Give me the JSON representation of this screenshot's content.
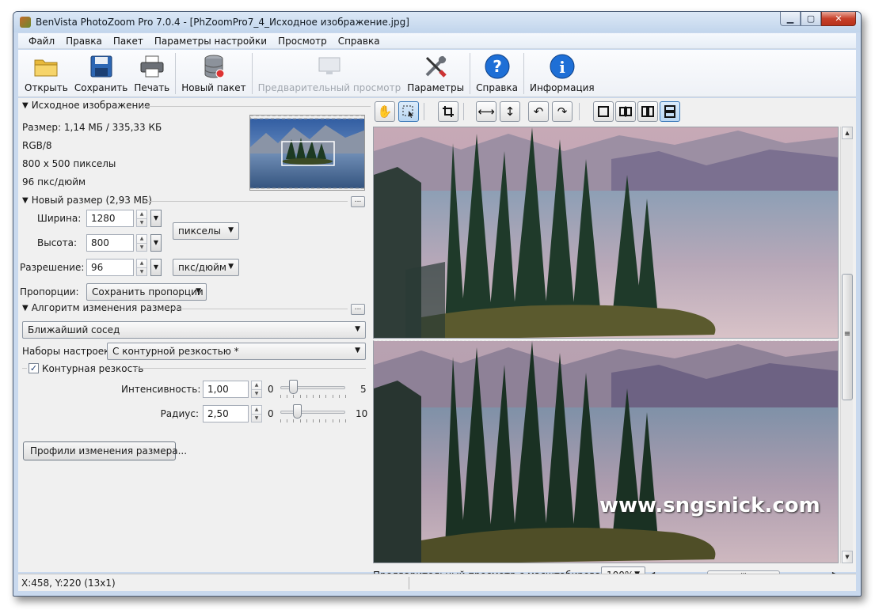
{
  "window": {
    "title": "BenVista PhotoZoom Pro 7.0.4 - [PhZoomPro7_4_Исходное изображение.jpg]"
  },
  "menu": [
    "Файл",
    "Правка",
    "Пакет",
    "Параметры настройки",
    "Просмотр",
    "Справка"
  ],
  "toolbar": {
    "open": "Открыть",
    "save": "Сохранить",
    "print": "Печать",
    "new_batch": "Новый пакет",
    "preview": "Предварительный просмотр",
    "settings": "Параметры",
    "help": "Справка",
    "info": "Информация"
  },
  "source": {
    "header": "Исходное изображение",
    "size": "Размер: 1,14 МБ / 335,33 КБ",
    "mode": "RGB/8",
    "dimensions": "800 x 500 пикселы",
    "dpi": "96 пкс/дюйм"
  },
  "new_size": {
    "header": "Новый размер (2,93 МБ)",
    "width_label": "Ширина:",
    "width_value": "1280",
    "height_label": "Высота:",
    "height_value": "800",
    "units": "пикселы",
    "resolution_label": "Разрешение:",
    "resolution_value": "96",
    "resolution_units": "пкс/дюйм",
    "proportions_label": "Пропорции:",
    "proportions_value": "Сохранить пропорции",
    "more_button": "..."
  },
  "algorithm": {
    "header": "Алгоритм изменения размера",
    "method": "Ближайший сосед",
    "presets_label": "Наборы настроек:",
    "presets_value": "С контурной резкостью *",
    "more_button": "..."
  },
  "sharpen": {
    "checkbox_label": "Контурная резкость",
    "checked": true,
    "intensity_label": "Интенсивность:",
    "intensity_value": "1,00",
    "intensity_min": "0",
    "intensity_max": "5",
    "intensity_level": 0.2,
    "radius_label": "Радиус:",
    "radius_value": "2,50",
    "radius_min": "0",
    "radius_max": "10",
    "radius_level": 0.25
  },
  "profiles_button": "Профили изменения размера...",
  "preview": {
    "zoom_label": "Предварительный просмотр с масштабированием:",
    "zoom_value": "100%",
    "hscroll_grip": "III",
    "vscroll_grip": "≡",
    "watermark": "www.sngsnick.com"
  },
  "status": {
    "coords": "X:458, Y:220  (13x1)"
  },
  "colors": {
    "accent": "#3a78b8",
    "help_blue": "#1e6fd6",
    "close_red": "#c7402a"
  }
}
